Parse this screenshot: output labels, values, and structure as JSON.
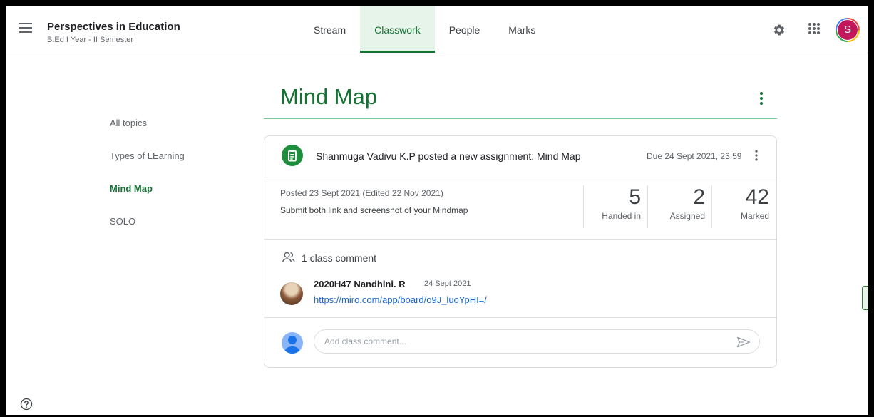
{
  "header": {
    "course_title": "Perspectives in Education",
    "course_subtitle": "B.Ed I Year - II Semester",
    "tabs": [
      {
        "label": "Stream"
      },
      {
        "label": "Classwork"
      },
      {
        "label": "People"
      },
      {
        "label": "Marks"
      }
    ],
    "active_tab": "Classwork",
    "user_initial": "S"
  },
  "topics": [
    {
      "label": "All topics"
    },
    {
      "label": "Types of LEarning"
    },
    {
      "label": "Mind Map"
    },
    {
      "label": "SOLO"
    }
  ],
  "active_topic": "Mind Map",
  "topic_heading": "Mind Map",
  "assignment": {
    "title": "Shanmuga Vadivu K.P posted a new assignment: Mind Map",
    "due": "Due 24 Sept 2021, 23:59",
    "posted": "Posted 23 Sept 2021 (Edited 22 Nov 2021)",
    "instructions": "Submit both link and screenshot of your Mindmap",
    "stats": [
      {
        "value": "5",
        "label": "Handed in"
      },
      {
        "value": "2",
        "label": "Assigned"
      },
      {
        "value": "42",
        "label": "Marked"
      }
    ]
  },
  "comments": {
    "count_label": "1 class comment",
    "items": [
      {
        "author": "2020H47 Nandhini. R",
        "date": "24 Sept 2021",
        "link": "https://miro.com/app/board/o9J_luoYpHI=/"
      }
    ],
    "input_placeholder": "Add class comment..."
  },
  "colors": {
    "accent": "#137333",
    "link": "#1967d2",
    "assignment_icon": "#1e8e3e"
  },
  "icons": {
    "menu": "menu-icon",
    "settings": "gear-icon",
    "apps": "apps-grid-icon",
    "assignment": "assignment-icon",
    "more": "more-vert-icon",
    "people": "people-icon",
    "send": "send-icon",
    "help": "help-icon"
  }
}
